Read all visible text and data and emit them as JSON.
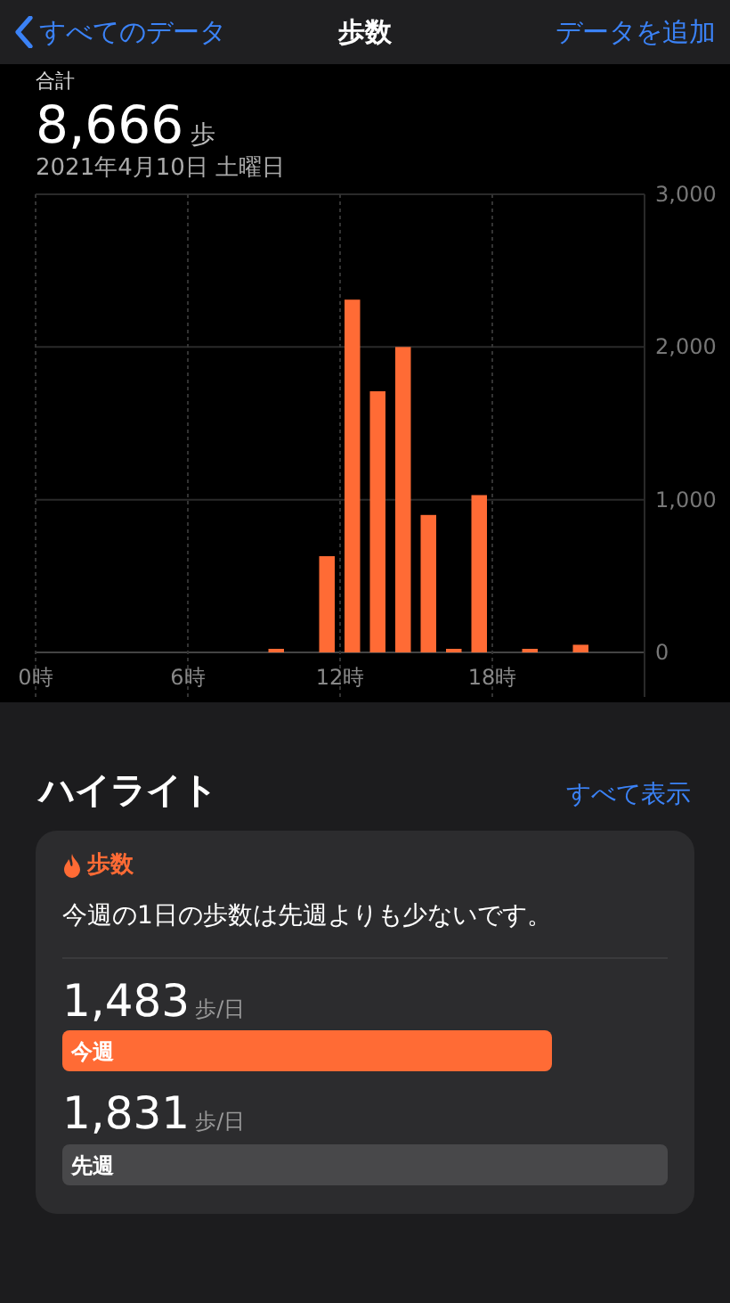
{
  "nav": {
    "back": "すべてのデータ",
    "title": "歩数",
    "action": "データを追加"
  },
  "summary": {
    "label": "合計",
    "value": "8,666",
    "unit": "歩",
    "date": "2021年4月10日 土曜日"
  },
  "chart": {
    "chart_data": {
      "type": "bar",
      "x": [
        9.5,
        11.5,
        12.5,
        13.5,
        14.5,
        15.5,
        16.5,
        17.5,
        19.5,
        21.5
      ],
      "series": [
        {
          "color": "#ff6b35",
          "values": [
            10,
            630,
            2310,
            1710,
            2000,
            900,
            20,
            1030,
            20,
            50
          ]
        }
      ],
      "xlim": [
        0,
        24
      ],
      "grid": true,
      "ylim": [
        0,
        3000
      ],
      "yticks": [
        {
          "value": 0,
          "label": "0"
        },
        {
          "value": 1000,
          "label": "1,000"
        },
        {
          "value": 2000,
          "label": "2,000"
        },
        {
          "value": 3000,
          "label": "3,000"
        }
      ],
      "xticks": [
        {
          "value": 0,
          "label": "0時"
        },
        {
          "value": 6,
          "label": "6時"
        },
        {
          "value": 12,
          "label": "12時"
        },
        {
          "value": 18,
          "label": "18時"
        }
      ]
    }
  },
  "highlights": {
    "title": "ハイライト",
    "show_all": "すべて表示",
    "card": {
      "category": "歩数",
      "message": "今週の1日の歩数は先週よりも少ないです。",
      "rows": [
        {
          "value": "1,483",
          "unit": "歩/日",
          "label": "今週",
          "kind": "current"
        },
        {
          "value": "1,831",
          "unit": "歩/日",
          "label": "先週",
          "kind": "previous"
        }
      ]
    }
  }
}
